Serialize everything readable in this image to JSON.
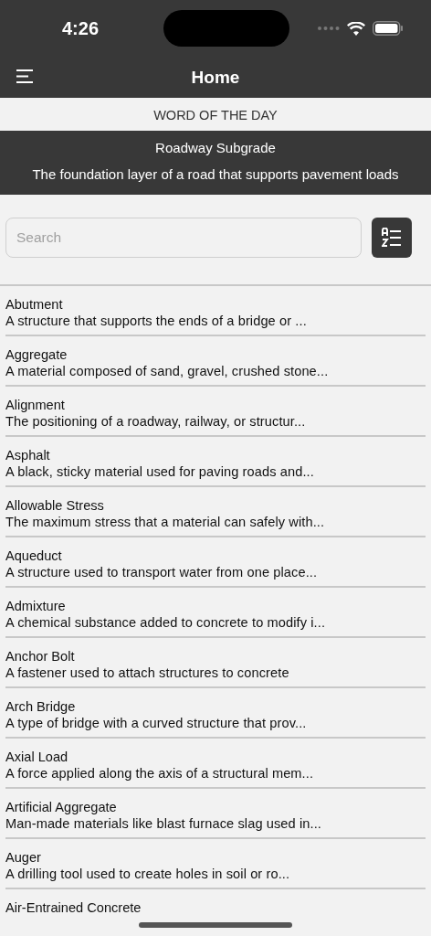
{
  "status_bar": {
    "time": "4:26"
  },
  "header": {
    "title": "Home"
  },
  "word_of_the_day": {
    "heading": "WORD OF THE DAY",
    "term": "Roadway Subgrade",
    "definition": "The foundation layer of a road that supports pavement loads"
  },
  "search": {
    "placeholder": "Search"
  },
  "terms": [
    {
      "term": "Abutment",
      "definition": "A structure that supports the ends of a bridge or ..."
    },
    {
      "term": "Aggregate",
      "definition": "A material composed of sand, gravel, crushed stone..."
    },
    {
      "term": "Alignment",
      "definition": "The positioning of a roadway, railway, or structur..."
    },
    {
      "term": "Asphalt",
      "definition": "A black, sticky material used for paving roads and..."
    },
    {
      "term": "Allowable Stress",
      "definition": "The maximum stress that a material can safely with..."
    },
    {
      "term": "Aqueduct",
      "definition": "A structure used to transport water from one place..."
    },
    {
      "term": "Admixture",
      "definition": "A chemical substance added to concrete to modify i..."
    },
    {
      "term": "Anchor Bolt",
      "definition": "A fastener used to attach structures to concrete"
    },
    {
      "term": "Arch Bridge",
      "definition": "A type of bridge with a curved structure that prov..."
    },
    {
      "term": "Axial Load",
      "definition": "A force applied along the axis of a structural mem..."
    },
    {
      "term": "Artificial Aggregate",
      "definition": "Man-made materials like blast furnace slag used in..."
    },
    {
      "term": "Auger",
      "definition": "A drilling tool used to create holes in soil or ro..."
    },
    {
      "term": "Air-Entrained Concrete"
    }
  ]
}
